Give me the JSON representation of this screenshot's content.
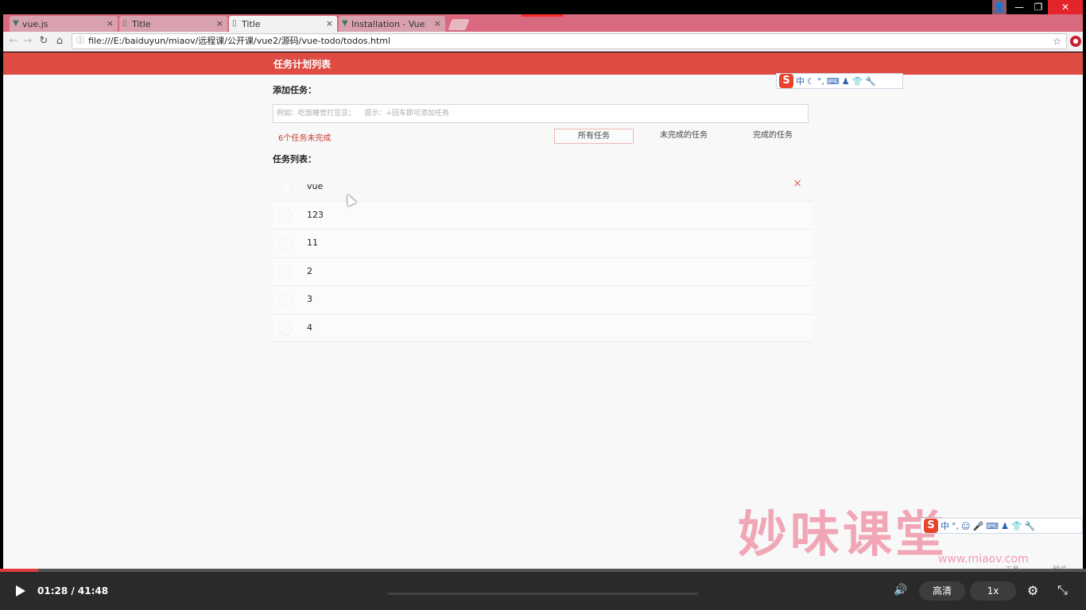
{
  "browser": {
    "tabs": [
      {
        "title": "vue.js",
        "icon": "vue-logo-icon",
        "active": false
      },
      {
        "title": "Title",
        "icon": "document-icon",
        "active": false
      },
      {
        "title": "Title",
        "icon": "document-icon",
        "active": true
      },
      {
        "title": "Installation - Vue.js",
        "icon": "vue-logo-icon",
        "active": false
      }
    ],
    "url": "file:///E:/baiduyun/miaov/远程课/公开课/vue2/源码/vue-todo/todos.html",
    "close_glyph": "×"
  },
  "app": {
    "header_title": "任务计划列表",
    "add_label": "添加任务：",
    "input_placeholder": "例如：吃饭睡觉打豆豆；    提示：+回车即可添加任务",
    "remaining_text": "6个任务未完成",
    "filters": [
      {
        "label": "所有任务",
        "selected": true
      },
      {
        "label": "未完成的任务",
        "selected": false
      },
      {
        "label": "完成的任务",
        "selected": false
      }
    ],
    "list_label": "任务列表：",
    "todos": [
      "vue",
      "123",
      "11",
      "2",
      "3",
      "4"
    ],
    "delete_glyph": "×",
    "accent_color": "#dd4b43"
  },
  "ime": {
    "logo": "S",
    "mode": "中",
    "punct": "°,"
  },
  "watermark": {
    "title": "妙味课堂",
    "url": "www.miaov.com",
    "tools_label": "工具",
    "preview_label": "预览"
  },
  "player": {
    "time": "01:28 / 41:48",
    "quality": "高清",
    "speed": "1x",
    "progress_fraction": 0.035
  }
}
